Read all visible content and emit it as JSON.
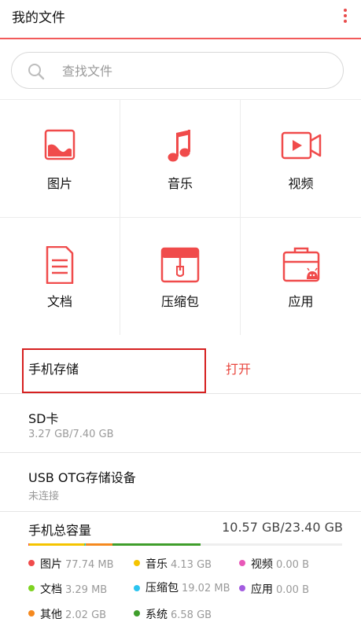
{
  "header": {
    "title": "我的文件"
  },
  "search": {
    "placeholder": "查找文件"
  },
  "categories": [
    {
      "label": "图片",
      "icon": "image-icon"
    },
    {
      "label": "音乐",
      "icon": "music-note-icon"
    },
    {
      "label": "视频",
      "icon": "video-camera-icon"
    },
    {
      "label": "文档",
      "icon": "document-icon"
    },
    {
      "label": "压缩包",
      "icon": "archive-icon"
    },
    {
      "label": "应用",
      "icon": "android-app-icon"
    }
  ],
  "storage": {
    "phone": {
      "label": "手机存储",
      "action": "打开"
    },
    "sd": {
      "label": "SD卡",
      "usage": "3.27 GB/7.40 GB"
    },
    "otg": {
      "label": "USB OTG存储设备",
      "status": "未连接"
    }
  },
  "capacity": {
    "title": "手机总容量",
    "value": "10.57 GB/23.40 GB",
    "total_gb": 23.4,
    "used_gb": 10.57,
    "breakdown": [
      {
        "name": "图片",
        "size": "77.74 MB",
        "color": "#f04b4b",
        "gb": 0.076
      },
      {
        "name": "音乐",
        "size": "4.13 GB",
        "color": "#f5c400",
        "gb": 4.13
      },
      {
        "name": "视频",
        "size": "0.00 B",
        "color": "#e858b8",
        "gb": 0
      },
      {
        "name": "文档",
        "size": "3.29 MB",
        "color": "#7ed321",
        "gb": 0.003
      },
      {
        "name": "压缩包",
        "size": "19.02 MB",
        "color": "#2bc4f0",
        "gb": 0.019
      },
      {
        "name": "应用",
        "size": "0.00 B",
        "color": "#a35ce0",
        "gb": 0
      },
      {
        "name": "其他",
        "size": "2.02 GB",
        "color": "#f5891f",
        "gb": 2.02
      },
      {
        "name": "系统",
        "size": "6.58 GB",
        "color": "#3f9e2b",
        "gb": 6.58
      }
    ]
  },
  "colors": {
    "accent": "#f25a5a",
    "highlight_border": "#d62020"
  }
}
